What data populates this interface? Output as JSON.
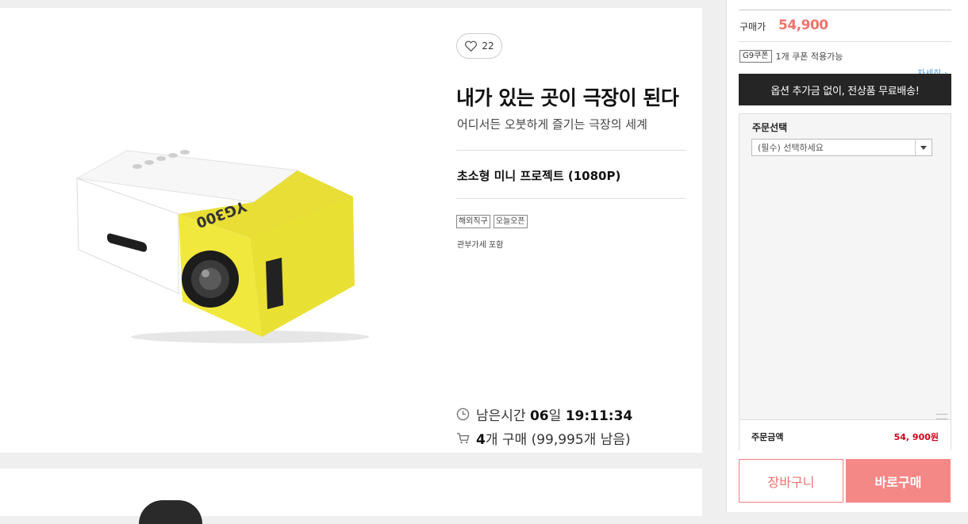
{
  "product": {
    "like_count": "22",
    "title": "내가 있는 곳이 극장이 된다",
    "subtitle": "어디서든 오붓하게 즐기는 극장의 세계",
    "name": "초소형 미니 프로젝트 (1080P)",
    "badges": [
      "해외직구",
      "오늘오픈"
    ],
    "tax_note": "관부가세 포함",
    "image_brand_text": "YG300"
  },
  "deal": {
    "remaining_label": "남은시간",
    "days_value": "06",
    "days_unit": "일",
    "time_value": "19:11:34",
    "purchase_count": "4",
    "purchase_label": "개 구매 (99,995개 남음)"
  },
  "side": {
    "price_label": "구매가",
    "price_value": "54,900",
    "coupon_tag": "G9쿠폰",
    "coupon_text": "1개 쿠폰 적용가능",
    "detail_link": "자세히",
    "banner_text": "옵션 추가금 없이, 전상품 무료배송!",
    "order_title": "주문선택",
    "select_placeholder": "(필수) 선택하세요",
    "total_label": "주문금액",
    "total_value": "54, 900원",
    "cart_button": "장바구니",
    "buy_button": "바로구매"
  },
  "colors": {
    "price": "#f2726f",
    "total": "#d0021b",
    "buy_button": "#f48886",
    "banner": "#252525",
    "link": "#4a9fd8"
  },
  "icons": [
    "heart-icon",
    "clock-icon",
    "cart-icon",
    "chevron-down-icon",
    "chevron-right-icon"
  ]
}
